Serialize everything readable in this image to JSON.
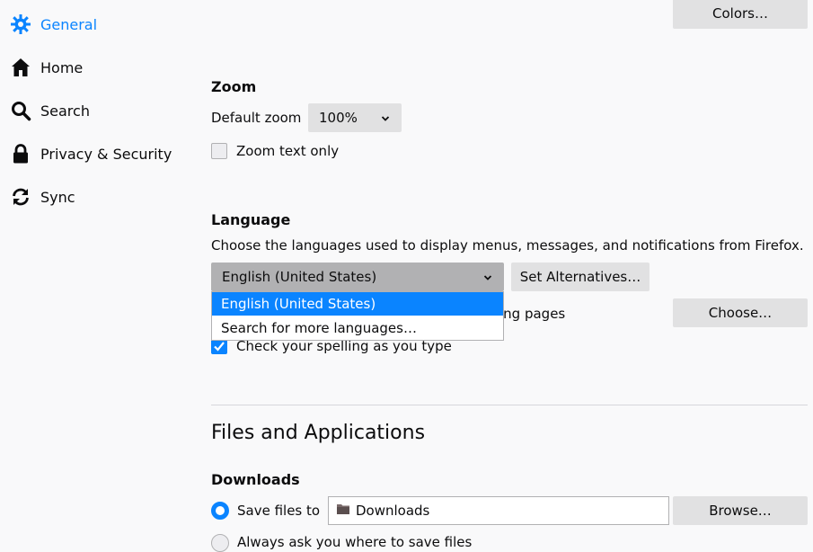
{
  "sidebar": {
    "items": [
      {
        "label": "General",
        "icon": "gear-icon",
        "selected": true
      },
      {
        "label": "Home",
        "icon": "home-icon"
      },
      {
        "label": "Search",
        "icon": "search-icon"
      },
      {
        "label": "Privacy & Security",
        "icon": "lock-icon"
      },
      {
        "label": "Sync",
        "icon": "sync-icon"
      }
    ]
  },
  "fonts_colors": {
    "colors_button": "Colors…"
  },
  "zoom": {
    "heading": "Zoom",
    "default_label": "Default zoom",
    "default_value": "100%",
    "text_only_label": "Zoom text only",
    "text_only_checked": false
  },
  "language": {
    "heading": "Language",
    "description": "Choose the languages used to display menus, messages, and notifications from Firefox.",
    "selected": "English (United States)",
    "alternatives_button": "Set Alternatives…",
    "options": [
      "English (United States)",
      "Search for more languages…"
    ],
    "pages_label_visible": "ing pages",
    "choose_button": "Choose…",
    "spelling_label": "Check your spelling as you type",
    "spelling_checked": true
  },
  "files": {
    "heading": "Files and Applications",
    "downloads_heading": "Downloads",
    "save_files_label": "Save files to",
    "save_files_checked": true,
    "folder": "Downloads",
    "browse_button": "Browse…",
    "always_ask_label": "Always ask you where to save files",
    "always_ask_checked": false
  },
  "colors": {
    "accent": "#0a84ff",
    "button": "#e1e1e2",
    "background": "#f9f9fa"
  }
}
